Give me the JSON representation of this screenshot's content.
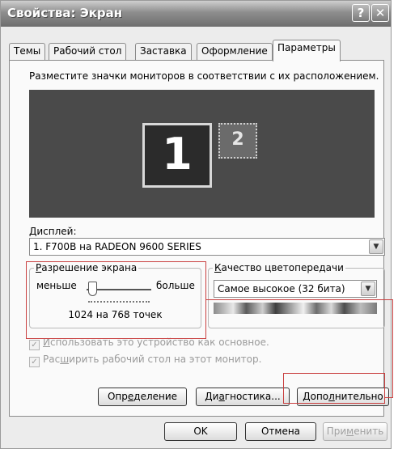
{
  "window": {
    "title": "Свойства: Экран",
    "help_glyph": "?",
    "close_glyph": "✕"
  },
  "tabs": [
    {
      "label": "Темы",
      "active": false
    },
    {
      "label": "Рабочий стол",
      "active": false
    },
    {
      "label": "Заставка",
      "active": false
    },
    {
      "label": "Оформление",
      "active": false
    },
    {
      "label": "Параметры",
      "active": true
    }
  ],
  "settings": {
    "instruction": "Разместите значки мониторов в соответствии с их расположением.",
    "monitors": [
      "1",
      "2"
    ],
    "display_label_u": "Д",
    "display_label_rest": "исплей:",
    "display_value": "1. F700B на RADEON 9600 SERIES",
    "resolution": {
      "legend_u": "Р",
      "legend_rest": "азрешение экрана",
      "less": "меньше",
      "more": "больше",
      "value": "1024 на 768 точек"
    },
    "color_quality": {
      "legend_u": "К",
      "legend_rest": "ачество цветопередачи",
      "value": "Самое высокое (32 бита)"
    },
    "checkbox_primary": {
      "u": "И",
      "rest": "спользовать это устройство как основное.",
      "checked": true,
      "enabled": false
    },
    "checkbox_extend": {
      "pre": "Рас",
      "u": "ш",
      "rest": "ирить рабочий стол на этот монитор.",
      "checked": true,
      "enabled": false
    }
  },
  "buttons": {
    "identify": {
      "pre": "Опр",
      "u": "е",
      "rest": "деление"
    },
    "diagnostics": {
      "pre": "Ди",
      "u": "а",
      "rest": "гностика..."
    },
    "advanced": {
      "pre": "Допо",
      "u": "л",
      "rest": "нительно"
    },
    "ok": "OK",
    "cancel": "Отмена",
    "apply": {
      "pre": "При",
      "u": "м",
      "rest": "енить"
    }
  },
  "colors": {
    "callout": "#c94040",
    "monitor_area": "#4a4a4a"
  }
}
